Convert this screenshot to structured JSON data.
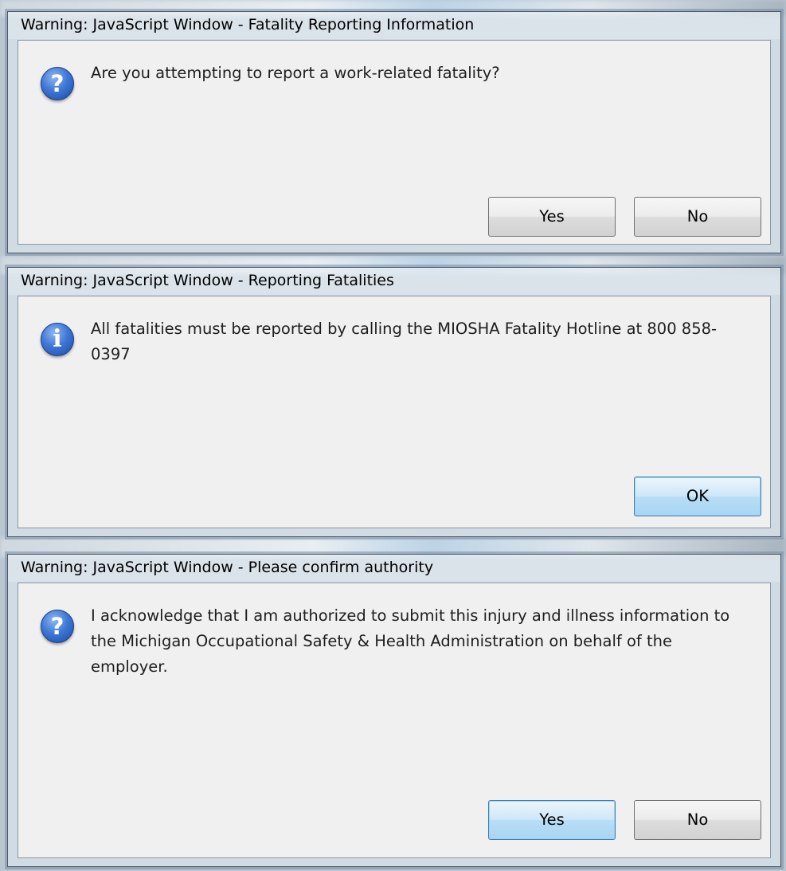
{
  "dialogs": [
    {
      "title": "Warning: JavaScript Window - Fatality Reporting Information",
      "icon": "question-icon",
      "message": "Are you attempting to report a work-related fatality?",
      "buttons": [
        "Yes",
        "No"
      ]
    },
    {
      "title": "Warning: JavaScript Window - Reporting Fatalities",
      "icon": "info-icon",
      "message": "All fatalities must be reported by calling the MIOSHA Fatality Hotline at 800 858-0397",
      "buttons": [
        "OK"
      ]
    },
    {
      "title": "Warning: JavaScript Window - Please confirm authority",
      "icon": "question-icon",
      "message": "I acknowledge that I am authorized to submit this injury and illness information to the Michigan Occupational Safety & Health Administration on behalf of the employer.",
      "buttons": [
        "Yes",
        "No"
      ]
    }
  ],
  "glyphs": {
    "question": "?",
    "info": "i"
  }
}
